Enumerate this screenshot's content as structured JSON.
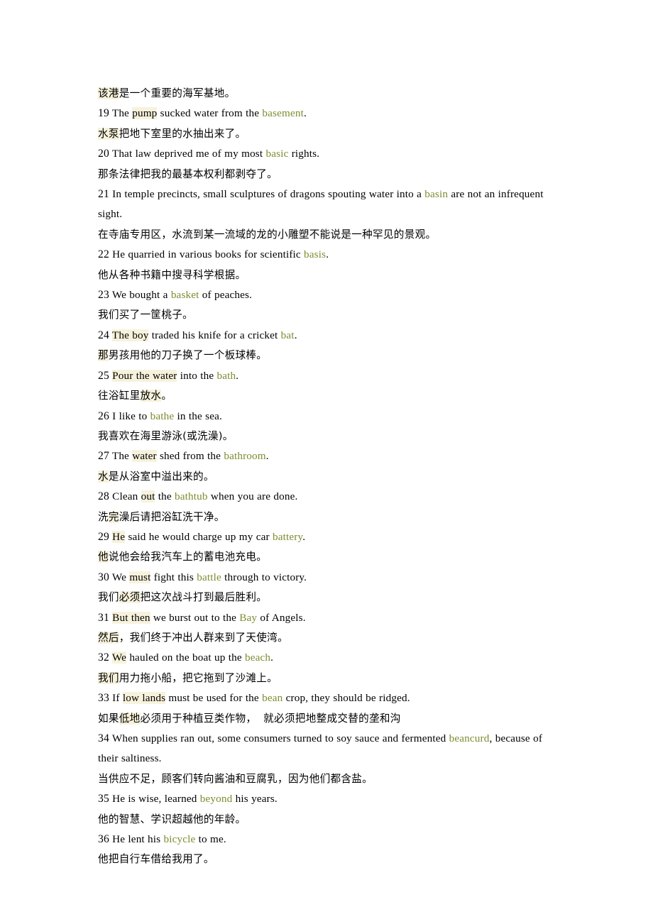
{
  "document": {
    "type": "bilingual-vocabulary-example-sentences",
    "colors": {
      "page_background": "#ffffff",
      "body_text": "#000000",
      "keyword_green": "#7d8c2e",
      "highlight_cream": "#f7f2dc"
    },
    "lines": [
      {
        "id": "line-zh-orphan-18",
        "lang": "zh",
        "number": "",
        "segments": [
          {
            "text": "该港",
            "style": "highlight"
          },
          {
            "text": "是一个重要的海军基地。",
            "style": "plain"
          }
        ]
      },
      {
        "id": "line-en-19",
        "lang": "en",
        "number": "19",
        "segments": [
          {
            "text": " The ",
            "style": "plain"
          },
          {
            "text": "pump",
            "style": "highlight"
          },
          {
            "text": " sucked water from the ",
            "style": "plain"
          },
          {
            "text": "basement",
            "style": "keyword"
          },
          {
            "text": ".",
            "style": "plain"
          }
        ]
      },
      {
        "id": "line-zh-19",
        "lang": "zh",
        "number": "",
        "segments": [
          {
            "text": "水泵",
            "style": "highlight"
          },
          {
            "text": "把地下室里的水抽出来了。",
            "style": "plain"
          }
        ]
      },
      {
        "id": "line-en-20",
        "lang": "en",
        "number": "20",
        "segments": [
          {
            "text": " That law deprived me of my most ",
            "style": "plain"
          },
          {
            "text": "basic",
            "style": "keyword"
          },
          {
            "text": " rights.",
            "style": "plain"
          }
        ]
      },
      {
        "id": "line-zh-20",
        "lang": "zh",
        "number": "",
        "segments": [
          {
            "text": "那条法律把我的最基本权利都剥夺了。",
            "style": "plain"
          }
        ]
      },
      {
        "id": "line-en-21",
        "lang": "en",
        "number": "21",
        "segments": [
          {
            "text": " In temple precincts, small sculptures of dragons spouting water into a ",
            "style": "plain"
          },
          {
            "text": "basin",
            "style": "keyword"
          },
          {
            "text": " are not an infrequent sight.",
            "style": "plain"
          }
        ]
      },
      {
        "id": "line-zh-21",
        "lang": "zh",
        "number": "",
        "segments": [
          {
            "text": "在寺庙专用区，水流到某一流域的龙的小雕塑不能说是一种罕见的景观。",
            "style": "plain"
          }
        ]
      },
      {
        "id": "line-en-22",
        "lang": "en",
        "number": "22",
        "segments": [
          {
            "text": " He quarried in various books for scientific ",
            "style": "plain"
          },
          {
            "text": "basis",
            "style": "keyword"
          },
          {
            "text": ".",
            "style": "plain"
          }
        ]
      },
      {
        "id": "line-zh-22",
        "lang": "zh",
        "number": "",
        "segments": [
          {
            "text": "他从各种书籍中搜寻科学根据。",
            "style": "plain"
          }
        ]
      },
      {
        "id": "line-en-23",
        "lang": "en",
        "number": "23",
        "segments": [
          {
            "text": " We bought a ",
            "style": "plain"
          },
          {
            "text": "basket",
            "style": "keyword"
          },
          {
            "text": " of peaches.",
            "style": "plain"
          }
        ]
      },
      {
        "id": "line-zh-23",
        "lang": "zh",
        "number": "",
        "segments": [
          {
            "text": "我们买了一筐桃子。",
            "style": "plain"
          }
        ]
      },
      {
        "id": "line-en-24",
        "lang": "en",
        "number": "24",
        "segments": [
          {
            "text": " ",
            "style": "plain"
          },
          {
            "text": "The boy",
            "style": "highlight"
          },
          {
            "text": " traded his knife for a cricket ",
            "style": "plain"
          },
          {
            "text": "bat",
            "style": "keyword"
          },
          {
            "text": ".",
            "style": "plain"
          }
        ]
      },
      {
        "id": "line-zh-24",
        "lang": "zh",
        "number": "",
        "segments": [
          {
            "text": "那",
            "style": "highlight"
          },
          {
            "text": "男孩用他的刀子换了一个板球棒。",
            "style": "plain"
          }
        ]
      },
      {
        "id": "line-en-25",
        "lang": "en",
        "number": "25",
        "segments": [
          {
            "text": " ",
            "style": "plain"
          },
          {
            "text": "Pour the water",
            "style": "highlight"
          },
          {
            "text": " into the ",
            "style": "plain"
          },
          {
            "text": "bath",
            "style": "keyword"
          },
          {
            "text": ".",
            "style": "plain"
          }
        ]
      },
      {
        "id": "line-zh-25",
        "lang": "zh",
        "number": "",
        "segments": [
          {
            "text": "往浴缸里",
            "style": "plain"
          },
          {
            "text": "放水",
            "style": "highlight"
          },
          {
            "text": "。",
            "style": "plain"
          }
        ]
      },
      {
        "id": "line-en-26",
        "lang": "en",
        "number": "26",
        "segments": [
          {
            "text": " I like to ",
            "style": "plain"
          },
          {
            "text": "bathe",
            "style": "keyword"
          },
          {
            "text": " in the sea.",
            "style": "plain"
          }
        ]
      },
      {
        "id": "line-zh-26",
        "lang": "zh",
        "number": "",
        "segments": [
          {
            "text": "我喜欢在海里游泳(或洗澡)。",
            "style": "plain"
          }
        ]
      },
      {
        "id": "line-en-27",
        "lang": "en",
        "number": "27",
        "segments": [
          {
            "text": " The ",
            "style": "plain"
          },
          {
            "text": "water",
            "style": "highlight"
          },
          {
            "text": " shed from the ",
            "style": "plain"
          },
          {
            "text": "bathroom",
            "style": "keyword"
          },
          {
            "text": ".",
            "style": "plain"
          }
        ]
      },
      {
        "id": "line-zh-27",
        "lang": "zh",
        "number": "",
        "segments": [
          {
            "text": "水",
            "style": "highlight"
          },
          {
            "text": "是从浴室中溢出来的。",
            "style": "plain"
          }
        ]
      },
      {
        "id": "line-en-28",
        "lang": "en",
        "number": "28",
        "segments": [
          {
            "text": " Clean ",
            "style": "plain"
          },
          {
            "text": "out",
            "style": "highlight"
          },
          {
            "text": " the ",
            "style": "plain"
          },
          {
            "text": "bathtub",
            "style": "keyword"
          },
          {
            "text": " when you are done.",
            "style": "plain"
          }
        ]
      },
      {
        "id": "line-zh-28",
        "lang": "zh",
        "number": "",
        "segments": [
          {
            "text": "洗",
            "style": "plain"
          },
          {
            "text": "完",
            "style": "highlight"
          },
          {
            "text": "澡后请把浴缸洗干净。",
            "style": "plain"
          }
        ]
      },
      {
        "id": "line-en-29",
        "lang": "en",
        "number": "29",
        "segments": [
          {
            "text": " ",
            "style": "plain"
          },
          {
            "text": "He",
            "style": "highlight"
          },
          {
            "text": " said he would charge up my car ",
            "style": "plain"
          },
          {
            "text": "battery",
            "style": "keyword"
          },
          {
            "text": ".",
            "style": "plain"
          }
        ]
      },
      {
        "id": "line-zh-29",
        "lang": "zh",
        "number": "",
        "segments": [
          {
            "text": "他",
            "style": "highlight"
          },
          {
            "text": "说他会给我汽车上的蓄电池充电。",
            "style": "plain"
          }
        ]
      },
      {
        "id": "line-en-30",
        "lang": "en",
        "number": "30",
        "segments": [
          {
            "text": " We ",
            "style": "plain"
          },
          {
            "text": "must",
            "style": "highlight"
          },
          {
            "text": " fight this ",
            "style": "plain"
          },
          {
            "text": "battle",
            "style": "keyword"
          },
          {
            "text": " through to victory.",
            "style": "plain"
          }
        ]
      },
      {
        "id": "line-zh-30",
        "lang": "zh",
        "number": "",
        "segments": [
          {
            "text": "我们",
            "style": "plain"
          },
          {
            "text": "必须",
            "style": "highlight"
          },
          {
            "text": "把这次战斗打到最后胜利。",
            "style": "plain"
          }
        ]
      },
      {
        "id": "line-en-31",
        "lang": "en",
        "number": "31",
        "segments": [
          {
            "text": " ",
            "style": "plain"
          },
          {
            "text": "But then",
            "style": "highlight"
          },
          {
            "text": " we burst out to the ",
            "style": "plain"
          },
          {
            "text": "Bay",
            "style": "keyword"
          },
          {
            "text": " of Angels.",
            "style": "plain"
          }
        ]
      },
      {
        "id": "line-zh-31",
        "lang": "zh",
        "number": "",
        "segments": [
          {
            "text": "然后",
            "style": "highlight"
          },
          {
            "text": "，我们终于冲出人群来到了天使湾。",
            "style": "plain"
          }
        ]
      },
      {
        "id": "line-en-32",
        "lang": "en",
        "number": "32",
        "segments": [
          {
            "text": " ",
            "style": "plain"
          },
          {
            "text": "We",
            "style": "highlight"
          },
          {
            "text": " hauled on the boat up the ",
            "style": "plain"
          },
          {
            "text": "beach",
            "style": "keyword"
          },
          {
            "text": ".",
            "style": "plain"
          }
        ]
      },
      {
        "id": "line-zh-32",
        "lang": "zh",
        "number": "",
        "segments": [
          {
            "text": "我们",
            "style": "highlight"
          },
          {
            "text": "用力拖小船，把它拖到了沙滩上。",
            "style": "plain"
          }
        ]
      },
      {
        "id": "line-en-33",
        "lang": "en",
        "number": "33",
        "segments": [
          {
            "text": " If ",
            "style": "plain"
          },
          {
            "text": "low lands",
            "style": "highlight"
          },
          {
            "text": " must be used for the ",
            "style": "plain"
          },
          {
            "text": "bean",
            "style": "keyword"
          },
          {
            "text": " crop, they should be ridged.",
            "style": "plain"
          }
        ]
      },
      {
        "id": "line-zh-33",
        "lang": "zh",
        "number": "",
        "segments": [
          {
            "text": "如果",
            "style": "plain"
          },
          {
            "text": "低地",
            "style": "highlight"
          },
          {
            "text": "必须用于种植豆类作物，  就必须把地整成交替的垄和沟",
            "style": "plain"
          }
        ]
      },
      {
        "id": "line-en-34",
        "lang": "en",
        "number": "34",
        "segments": [
          {
            "text": " When supplies ran out, some consumers turned to soy sauce and fermented ",
            "style": "plain"
          },
          {
            "text": "beancurd",
            "style": "keyword"
          },
          {
            "text": ", because of their saltiness.",
            "style": "plain"
          }
        ]
      },
      {
        "id": "line-zh-34",
        "lang": "zh",
        "number": "",
        "segments": [
          {
            "text": "当供应不足，顾客们转向酱油和豆腐乳，因为他们都含盐。",
            "style": "plain"
          }
        ]
      },
      {
        "id": "line-en-35",
        "lang": "en",
        "number": "35",
        "segments": [
          {
            "text": " He is wise, learned ",
            "style": "plain"
          },
          {
            "text": "beyond",
            "style": "keyword"
          },
          {
            "text": " his years.",
            "style": "plain"
          }
        ]
      },
      {
        "id": "line-zh-35",
        "lang": "zh",
        "number": "",
        "segments": [
          {
            "text": "他的智慧、学识超越他的年龄。",
            "style": "plain"
          }
        ]
      },
      {
        "id": "line-en-36",
        "lang": "en",
        "number": "36",
        "segments": [
          {
            "text": " He lent his ",
            "style": "plain"
          },
          {
            "text": "bicycle",
            "style": "keyword"
          },
          {
            "text": " to me.",
            "style": "plain"
          }
        ]
      },
      {
        "id": "line-zh-36",
        "lang": "zh",
        "number": "",
        "segments": [
          {
            "text": "他把自行车借给我用了。",
            "style": "plain"
          }
        ]
      }
    ]
  }
}
